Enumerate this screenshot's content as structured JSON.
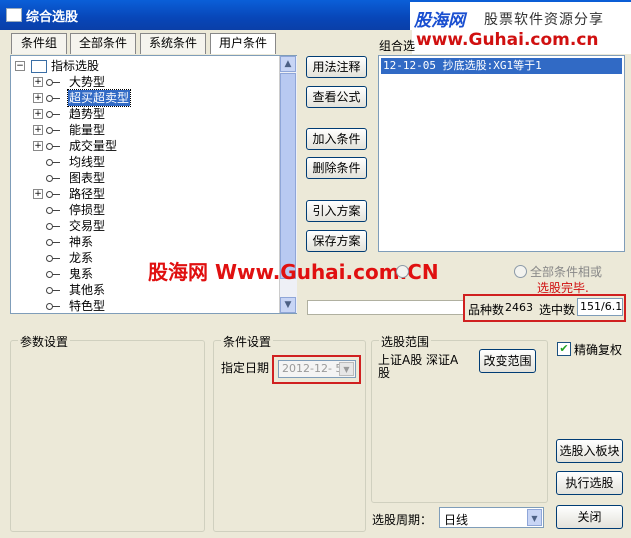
{
  "window": {
    "title": "综合选股"
  },
  "logo": {
    "brand": "股海网",
    "tagline": "股票软件资源分享",
    "url": "www.Guhai.com.cn"
  },
  "tabs": [
    "条件组",
    "全部条件",
    "系统条件",
    "用户条件"
  ],
  "tree": {
    "root": "指标选股",
    "items": [
      {
        "label": "大势型",
        "expandable": true
      },
      {
        "label": "超买超卖型",
        "expandable": true,
        "selected": true
      },
      {
        "label": "趋势型",
        "expandable": true
      },
      {
        "label": "能量型",
        "expandable": true
      },
      {
        "label": "成交量型",
        "expandable": true
      },
      {
        "label": "均线型",
        "expandable": false
      },
      {
        "label": "图表型",
        "expandable": false
      },
      {
        "label": "路径型",
        "expandable": true
      },
      {
        "label": "停损型",
        "expandable": false
      },
      {
        "label": "交易型",
        "expandable": false
      },
      {
        "label": "神系",
        "expandable": false
      },
      {
        "label": "龙系",
        "expandable": false
      },
      {
        "label": "鬼系",
        "expandable": false
      },
      {
        "label": "其他系",
        "expandable": false
      },
      {
        "label": "特色型",
        "expandable": false
      }
    ]
  },
  "mid_buttons": {
    "usage": "用法注释",
    "view_formula": "查看公式",
    "add_condition": "加入条件",
    "delete_condition": "删除条件",
    "import_plan": "引入方案",
    "save_plan": "保存方案"
  },
  "combo": {
    "label": "组合选",
    "items": [
      "12-12-05 抄底选股:XG1等于1"
    ],
    "radio_all_label": "全部条件相或",
    "status": "选股完毕."
  },
  "watermark": "股海网 Www.Guhai.com.CN",
  "stats": {
    "count_label": "品种数",
    "count": "2463",
    "selected_label": "选中数",
    "selected": "151/6.1"
  },
  "params": {
    "title": "参数设置"
  },
  "condition": {
    "title": "条件设置",
    "date_label": "指定日期",
    "date_value": "2012-12- 5"
  },
  "range": {
    "title": "选股范围",
    "value": "上证A股 深证A股",
    "change_button": "改变范围"
  },
  "right": {
    "exact_rights_label": "精确复权",
    "exact_rights_checked": true,
    "to_block": "选股入板块",
    "run": "执行选股",
    "close": "关闭"
  },
  "period": {
    "label": "选股周期：",
    "value": "日线"
  },
  "colors": {
    "title_bar": "#0846b8",
    "selection": "#316ac5",
    "highlight_red": "#d02020",
    "logo_blue": "#1a4fd0",
    "url_red": "#d01010"
  }
}
